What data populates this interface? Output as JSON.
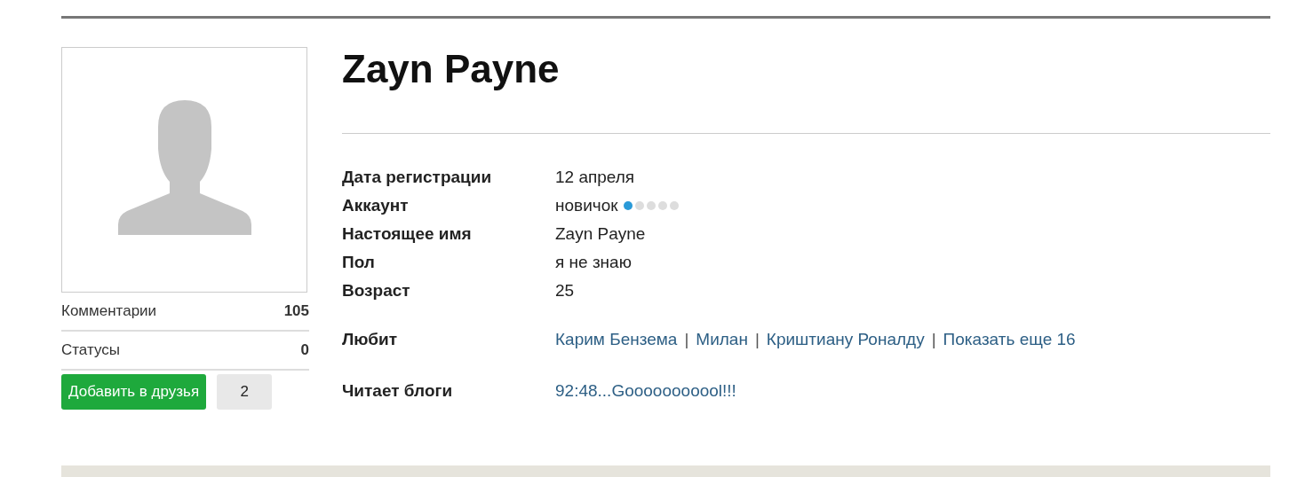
{
  "profile": {
    "name": "Zayn Payne"
  },
  "stats": [
    {
      "label": "Комментарии",
      "value": "105"
    },
    {
      "label": "Статусы",
      "value": "0"
    }
  ],
  "friend_button": {
    "label": "Добавить в друзья",
    "count": "2"
  },
  "details": [
    {
      "label": "Дата регистрации",
      "value": "12 апреля"
    },
    {
      "label": "Аккаунт",
      "value": "новичок",
      "level": 0.2
    },
    {
      "label": "Настоящее имя",
      "value": "Zayn Payne"
    },
    {
      "label": "Пол",
      "value": "я не знаю"
    },
    {
      "label": "Возраст",
      "value": "25"
    }
  ],
  "likes": {
    "label": "Любит",
    "separator": "|",
    "links": [
      "Карим Бензема",
      "Милан",
      "Криштиану Роналду",
      "Показать еще 16"
    ]
  },
  "blogs": {
    "label": "Читает блоги",
    "links": [
      "92:48...Gooooooooool!!!"
    ]
  }
}
